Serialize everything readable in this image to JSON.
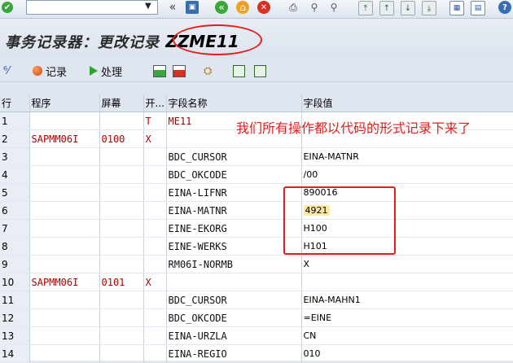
{
  "window": {
    "title": "事务记录器：更改记录",
    "tcode": "ZZME11"
  },
  "system_toolbar": {
    "icons": [
      "check-icon",
      "back-icon",
      "save-icon",
      "back-nav-icon",
      "exit-icon",
      "cancel-icon",
      "print-icon",
      "find-icon",
      "find-next-icon",
      "first-page-icon",
      "previous-page-icon",
      "next-page-icon",
      "last-page-icon",
      "new-session-icon",
      "shortcut-icon",
      "help-icon"
    ]
  },
  "app_toolbar": {
    "recording_label": "记录",
    "process_label": "处理"
  },
  "grid": {
    "headers": [
      "行",
      "程序",
      "屏幕",
      "开...",
      "字段名称",
      "字段值"
    ],
    "rows": [
      {
        "num": "1",
        "program": "",
        "screen": "",
        "start": "T",
        "field": "ME11",
        "value": ""
      },
      {
        "num": "2",
        "program": "SAPMM06I",
        "screen": "0100",
        "start": "X",
        "field": "",
        "value": ""
      },
      {
        "num": "3",
        "program": "",
        "screen": "",
        "start": "",
        "field": "BDC_CURSOR",
        "value": "EINA-MATNR"
      },
      {
        "num": "4",
        "program": "",
        "screen": "",
        "start": "",
        "field": "BDC_OKCODE",
        "value": "/00"
      },
      {
        "num": "5",
        "program": "",
        "screen": "",
        "start": "",
        "field": "EINA-LIFNR",
        "value": "890016"
      },
      {
        "num": "6",
        "program": "",
        "screen": "",
        "start": "",
        "field": "EINA-MATNR",
        "value": "4921"
      },
      {
        "num": "7",
        "program": "",
        "screen": "",
        "start": "",
        "field": "EINE-EKORG",
        "value": "H100"
      },
      {
        "num": "8",
        "program": "",
        "screen": "",
        "start": "",
        "field": "EINE-WERKS",
        "value": "H101"
      },
      {
        "num": "9",
        "program": "",
        "screen": "",
        "start": "",
        "field": "RM06I-NORMB",
        "value": "X"
      },
      {
        "num": "10",
        "program": "SAPMM06I",
        "screen": "0101",
        "start": "X",
        "field": "",
        "value": ""
      },
      {
        "num": "11",
        "program": "",
        "screen": "",
        "start": "",
        "field": "BDC_CURSOR",
        "value": "EINA-MAHN1"
      },
      {
        "num": "12",
        "program": "",
        "screen": "",
        "start": "",
        "field": "BDC_OKCODE",
        "value": "=EINE"
      },
      {
        "num": "13",
        "program": "",
        "screen": "",
        "start": "",
        "field": "EINA-URZLA",
        "value": "CN"
      },
      {
        "num": "14",
        "program": "",
        "screen": "",
        "start": "",
        "field": "EINA-REGIO",
        "value": "010"
      }
    ]
  },
  "annotation": {
    "text": "我们所有操作都以代码的形式记录下来了"
  },
  "colors": {
    "annotation": "#e41c1c",
    "program_text": "#b00000",
    "highlight": "#ffe9a6"
  }
}
